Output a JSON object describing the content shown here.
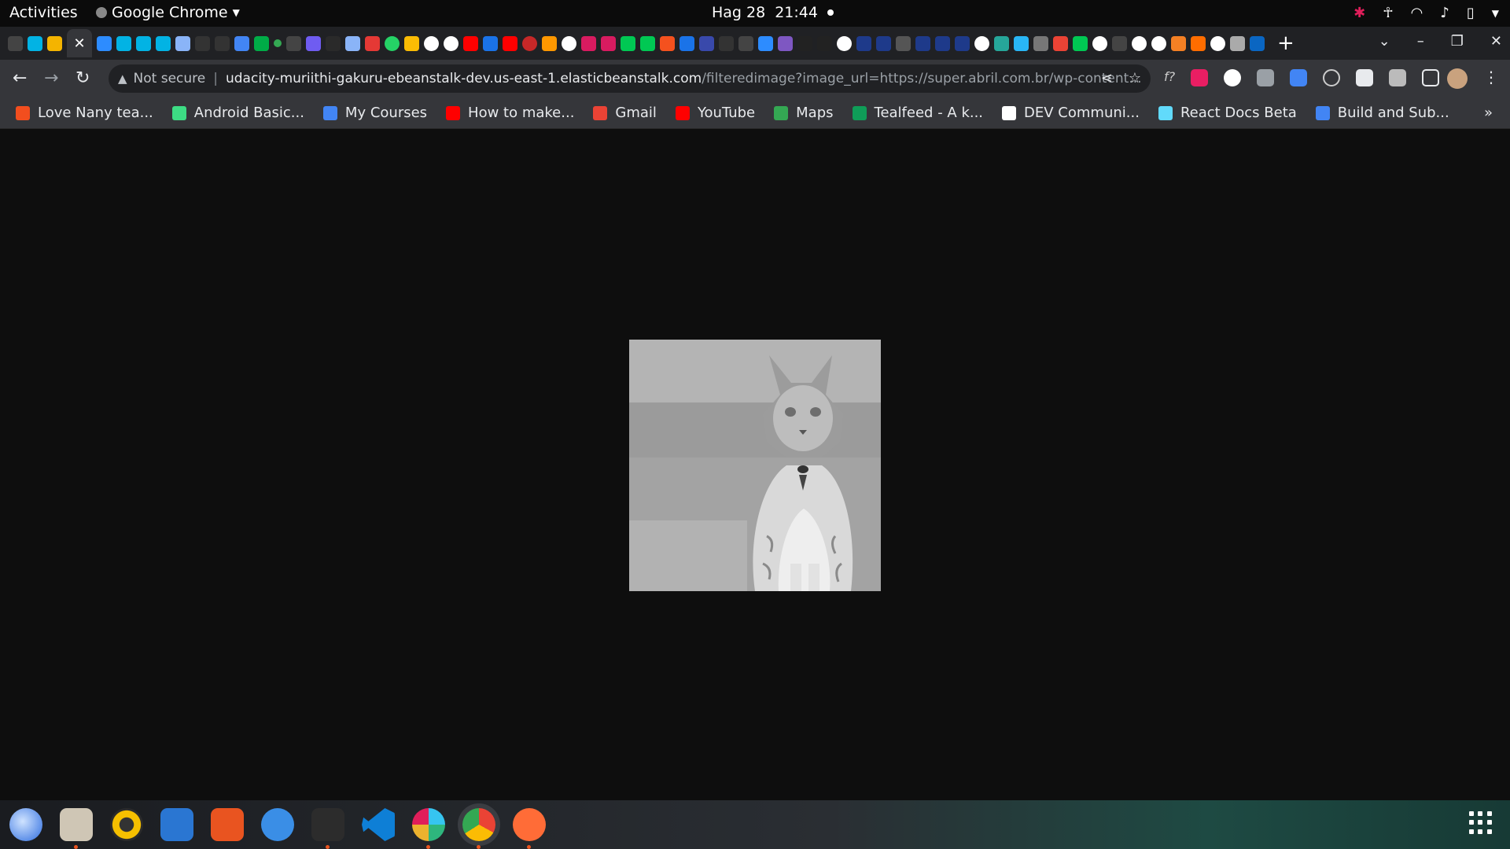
{
  "system_bar": {
    "activities": "Activities",
    "app_name": "Google Chrome",
    "date": "Hag 28",
    "time": "21:44"
  },
  "tabs": {
    "close_glyph": "✕",
    "new_tab_glyph": "+"
  },
  "address_bar": {
    "security_label": "Not secure",
    "host": "udacity-muriithi-gakuru-ebeanstalk-dev.us-east-1.elasticbeanstalk.com",
    "path": "/filteredimage?image_url=https://super.abril.com.br/wp-content..."
  },
  "bookmarks": [
    {
      "label": "Love Nany tea...",
      "color": "#f24e1e"
    },
    {
      "label": "Android Basic...",
      "color": "#3ddc84"
    },
    {
      "label": "My Courses",
      "color": "#4285f4"
    },
    {
      "label": "How to make...",
      "color": "#ff0000"
    },
    {
      "label": "Gmail",
      "color": "#ea4335"
    },
    {
      "label": "YouTube",
      "color": "#ff0000"
    },
    {
      "label": "Maps",
      "color": "#34a853"
    },
    {
      "label": "Tealfeed - A k...",
      "color": "#0f9d58"
    },
    {
      "label": "DEV Communi...",
      "color": "#ffffff"
    },
    {
      "label": "React Docs Beta",
      "color": "#61dafb"
    },
    {
      "label": "Build and Sub...",
      "color": "#4285f4"
    }
  ],
  "bookmarks_more": "»",
  "content": {
    "image_alt": "grayscale filtered cat photo"
  },
  "dock": {
    "apps": [
      "thunderbird",
      "files",
      "rhythmbox",
      "writer",
      "software",
      "help",
      "terminal",
      "vscode",
      "slack",
      "chrome",
      "postman"
    ]
  }
}
